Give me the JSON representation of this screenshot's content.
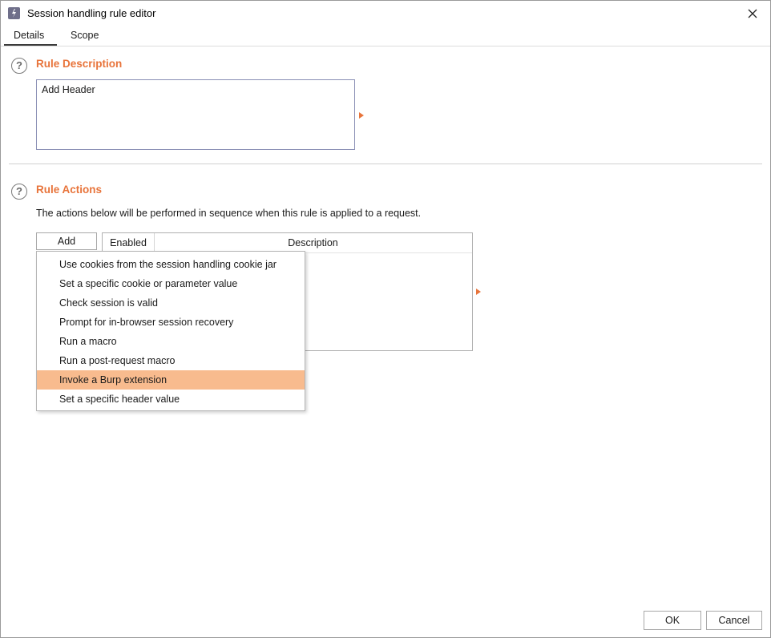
{
  "window": {
    "title": "Session handling rule editor",
    "icon": "burp-app-icon",
    "close_icon": "close-icon"
  },
  "tabs": [
    {
      "label": "Details",
      "selected": true
    },
    {
      "label": "Scope",
      "selected": false
    }
  ],
  "rule_description": {
    "heading": "Rule Description",
    "value": "Add Header"
  },
  "rule_actions": {
    "heading": "Rule Actions",
    "info": "The actions below will be performed in sequence when this rule is applied to a request.",
    "add_label": "Add",
    "columns": [
      "Enabled",
      "Description"
    ],
    "rows": []
  },
  "add_menu": {
    "items": [
      {
        "label": "Use cookies from the session handling cookie jar",
        "highlighted": false
      },
      {
        "label": "Set a specific cookie or parameter value",
        "highlighted": false
      },
      {
        "label": "Check session is valid",
        "highlighted": false
      },
      {
        "label": "Prompt for in-browser session recovery",
        "highlighted": false
      },
      {
        "label": "Run a macro",
        "highlighted": false
      },
      {
        "label": "Run a post-request macro",
        "highlighted": false
      },
      {
        "label": "Invoke a Burp extension",
        "highlighted": true
      },
      {
        "label": "Set a specific header value",
        "highlighted": false
      }
    ]
  },
  "footer": {
    "ok_label": "OK",
    "cancel_label": "Cancel"
  },
  "colors": {
    "accent": "#e8743b",
    "menu_highlight": "#f8bb8e"
  }
}
